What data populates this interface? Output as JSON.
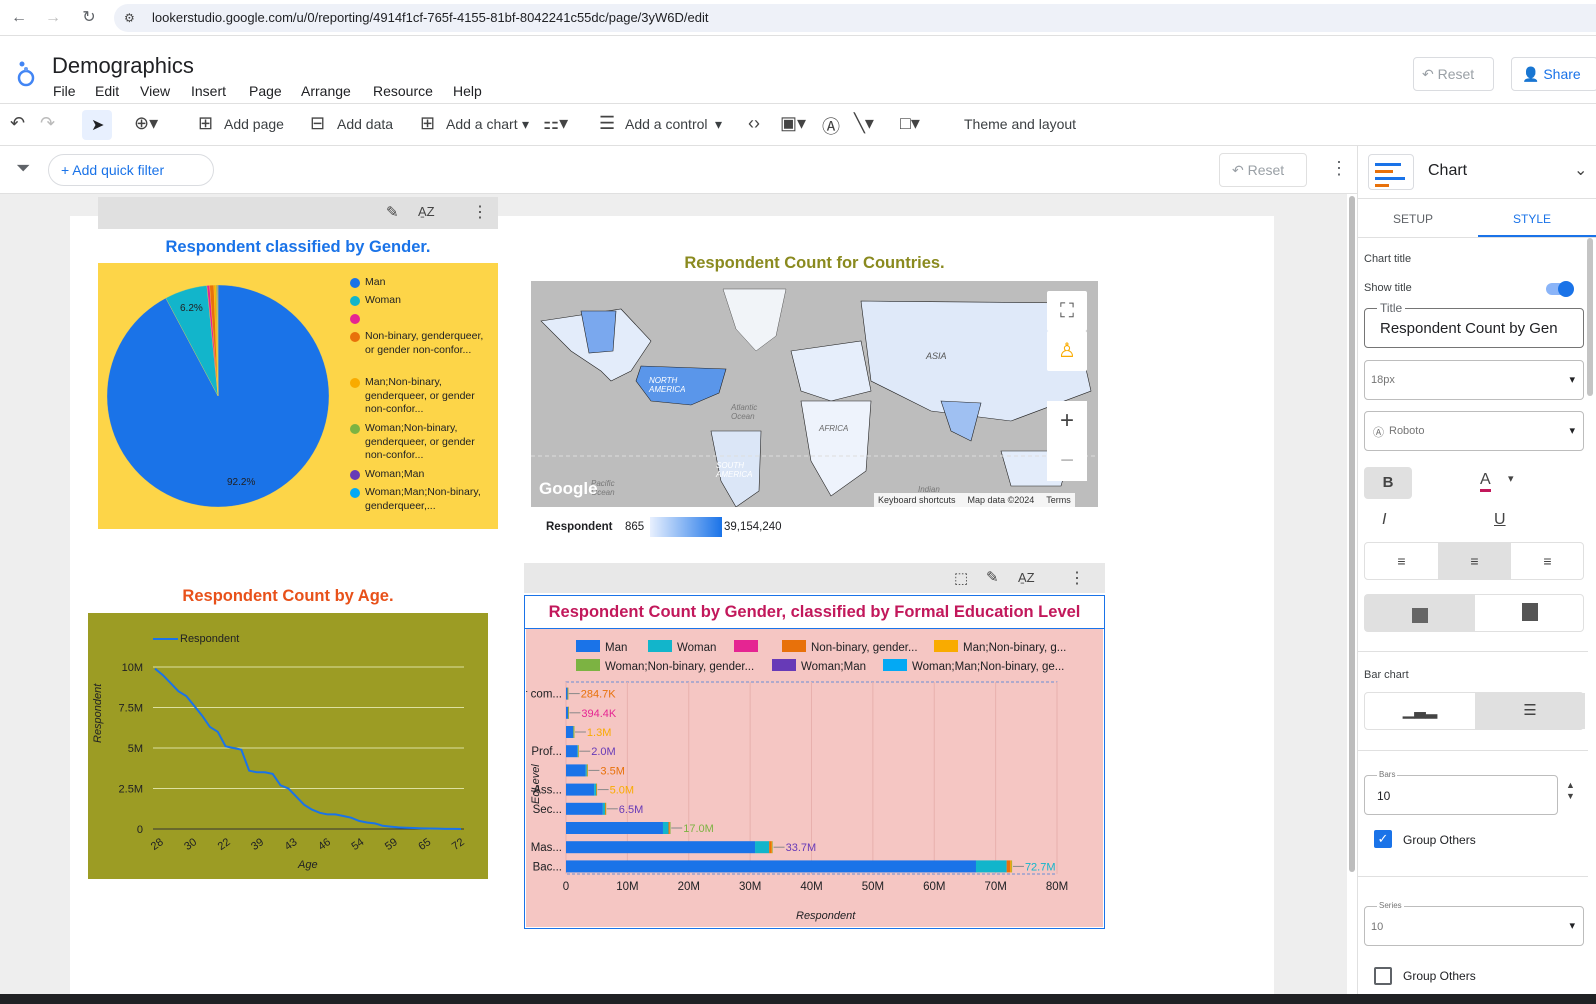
{
  "browser": {
    "url": "lookerstudio.google.com/u/0/reporting/4914f1cf-765f-4155-81bf-8042241c55dc/page/3yW6D/edit"
  },
  "app": {
    "title": "Demographics",
    "menu": [
      "File",
      "Edit",
      "View",
      "Insert",
      "Page",
      "Arrange",
      "Resource",
      "Help"
    ],
    "reset_label": "Reset",
    "share_label": "Share"
  },
  "toolbar": {
    "add_page": "Add page",
    "add_data": "Add data",
    "add_chart": "Add a chart",
    "add_control": "Add a control",
    "theme_layout": "Theme and layout"
  },
  "filter_bar": {
    "quick_filter": "+ Add quick filter",
    "reset_label": "Reset"
  },
  "pie": {
    "title": "Respondent classified by Gender.",
    "title_color": "#1a73e8",
    "background": "#fdd548",
    "legend": [
      {
        "label": "Man",
        "color": "#1a73e8"
      },
      {
        "label": "Woman",
        "color": "#12b5cb"
      },
      {
        "label": "",
        "color": "#e52592"
      },
      {
        "label": "Non-binary, genderqueer, or gender non-confor...",
        "color": "#e8710a"
      },
      {
        "label": "Man;Non-binary, genderqueer, or gender non-confor...",
        "color": "#f9ab00"
      },
      {
        "label": "Woman;Non-binary, genderqueer, or gender non-confor...",
        "color": "#7cb342"
      },
      {
        "label": "Woman;Man",
        "color": "#673ab7"
      },
      {
        "label": "Woman;Man;Non-binary, genderqueer,...",
        "color": "#03a9f4"
      }
    ],
    "label_man": "92.2%",
    "label_woman": "6.2%"
  },
  "map": {
    "title": "Respondent Count for Countries.",
    "title_color": "#8a8a1f",
    "legend_label": "Respondent",
    "legend_min": "865",
    "legend_max": "39,154,240",
    "attribution": [
      "Keyboard shortcuts",
      "Map data ©2024",
      "Terms"
    ],
    "google": "Google",
    "labels": {
      "asia": "ASIA",
      "na": "NORTH AMERICA",
      "sa": "SOUTH AMERICA",
      "africa": "AFRICA",
      "atlantic": "Atlantic Ocean",
      "pacific": "Pacific Ocean",
      "indian": "Indian"
    }
  },
  "line": {
    "title": "Respondent Count by Age.",
    "title_color": "#e8511a",
    "legend": "Respondent",
    "ylabel": "Respondent",
    "xlabel": "Age",
    "yticks": [
      "0",
      "2.5M",
      "5M",
      "7.5M",
      "10M"
    ],
    "xticks": [
      "28",
      "30",
      "22",
      "39",
      "43",
      "46",
      "54",
      "59",
      "65",
      "72"
    ]
  },
  "bar": {
    "title": "Respondent Count by Gender, classified by Formal Education Level",
    "title_color": "#c2185b",
    "legend": [
      {
        "label": "Man",
        "color": "#1a73e8"
      },
      {
        "label": "Woman",
        "color": "#12b5cb"
      },
      {
        "label": "",
        "color": "#e52592"
      },
      {
        "label": "Non-binary, gender...",
        "color": "#e8710a"
      },
      {
        "label": "Man;Non-binary, g...",
        "color": "#f9ab00"
      },
      {
        "label": "Woman;Non-binary, gender...",
        "color": "#7cb342"
      },
      {
        "label": "Woman;Man",
        "color": "#673ab7"
      },
      {
        "label": "Woman;Man;Non-binary, ge...",
        "color": "#03a9f4"
      }
    ],
    "ylabel": "EdLevel",
    "xlabel": "Respondent",
    "xticks": [
      "0",
      "10M",
      "20M",
      "30M",
      "40M",
      "50M",
      "60M",
      "70M",
      "80M"
    ]
  },
  "chart_data": [
    {
      "type": "pie",
      "title": "Respondent classified by Gender.",
      "categories": [
        "Man",
        "Woman",
        "",
        "Non-binary, genderqueer, or gender non-confor...",
        "Man;Non-binary, genderqueer, or gender non-confor...",
        "Woman;Non-binary, genderqueer, or gender non-confor...",
        "Woman;Man",
        "Woman;Man;Non-binary, genderqueer,..."
      ],
      "values": [
        92.2,
        6.2,
        0.4,
        0.6,
        0.3,
        0.15,
        0.1,
        0.05
      ]
    },
    {
      "type": "line",
      "title": "Respondent Count by Age.",
      "xlabel": "Age",
      "ylabel": "Respondent",
      "ylim": [
        0,
        11000000
      ],
      "series": [
        {
          "name": "Respondent",
          "values": [
            9900000,
            9500000,
            9000000,
            8500000,
            8200000,
            7600000,
            7000000,
            6300000,
            6000000,
            5100000,
            5000000,
            4900000,
            3600000,
            3500000,
            3500000,
            3400000,
            2700000,
            2500000,
            2000000,
            1500000,
            1200000,
            1000000,
            900000,
            900000,
            800000,
            700000,
            500000,
            400000,
            350000,
            200000,
            150000,
            100000,
            80000,
            60000,
            40000,
            30000,
            20000,
            10000,
            5000,
            2000
          ]
        }
      ]
    },
    {
      "type": "bar",
      "orientation": "horizontal",
      "stacked": true,
      "title": "Respondent Count by Gender, classified by Formal Education Level",
      "xlabel": "Respondent",
      "ylabel": "EdLevel",
      "xlim": [
        0,
        80000000
      ],
      "categories": [
        "I never com...",
        "",
        "",
        "Prof...",
        "",
        "Ass...",
        "Sec...",
        "",
        "Mas...",
        "Bac..."
      ],
      "totals_labels": [
        "284.7K",
        "394.4K",
        "1.3M",
        "2.0M",
        "3.5M",
        "5.0M",
        "6.5M",
        "17.0M",
        "33.7M",
        "72.7M"
      ],
      "label_colors": [
        "#e8710a",
        "#e52592",
        "#f9ab00",
        "#673ab7",
        "#e8710a",
        "#f9ab00",
        "#673ab7",
        "#7cb342",
        "#673ab7",
        "#12b5cb"
      ],
      "series": [
        {
          "name": "Man",
          "values": [
            260000,
            360000,
            1150000,
            1850000,
            3200000,
            4600000,
            6000000,
            15800000,
            30800000,
            66800000
          ]
        },
        {
          "name": "Woman",
          "values": [
            15000,
            20000,
            90000,
            100000,
            200000,
            300000,
            350000,
            900000,
            2300000,
            5000000
          ]
        },
        {
          "name": "Non-binary, gender...",
          "values": [
            5000,
            7000,
            30000,
            30000,
            60000,
            60000,
            90000,
            200000,
            400000,
            600000
          ]
        },
        {
          "name": "Man;Non-binary, g...",
          "values": [
            2000,
            3000,
            10000,
            10000,
            20000,
            20000,
            30000,
            50000,
            100000,
            200000
          ]
        },
        {
          "name": "Woman;Non-binary, gender...",
          "values": [
            1000,
            2000,
            10000,
            5000,
            10000,
            10000,
            15000,
            30000,
            60000,
            60000
          ]
        }
      ]
    }
  ],
  "right_panel": {
    "header": "Chart",
    "tab_setup": "SETUP",
    "tab_style": "STYLE",
    "chart_title_label": "Chart title",
    "show_title_label": "Show title",
    "title_field_label": "Title",
    "title_field_value": "Respondent Count by Gen",
    "font_size": "18px",
    "font_family": "Roboto",
    "bar_chart_label": "Bar chart",
    "bars_label": "Bars",
    "bars_value": "10",
    "group_others_1": "Group Others",
    "series_label": "Series",
    "series_value": "10",
    "group_others_2": "Group Others"
  }
}
